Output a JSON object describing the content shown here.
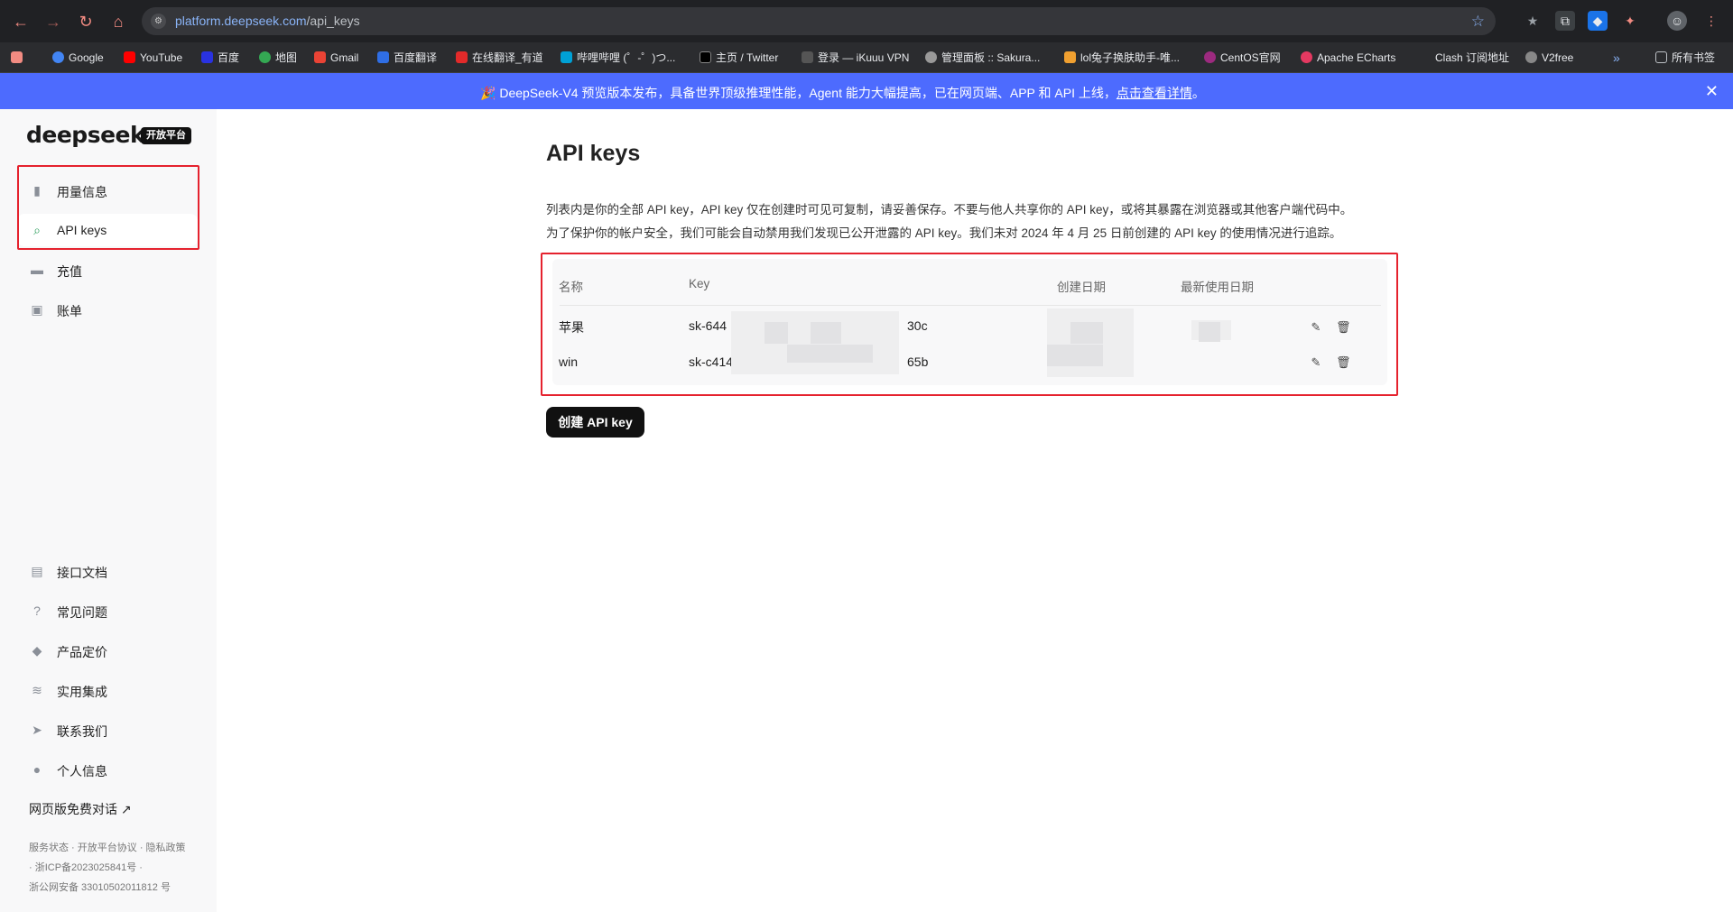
{
  "browser": {
    "url_host": "platform.deepseek.com",
    "url_path": "/api_keys",
    "bookmarks": [
      {
        "label": "Google",
        "color": "#4285f4"
      },
      {
        "label": "YouTube",
        "color": "#ff0000"
      },
      {
        "label": "百度",
        "color": "#2932e1"
      },
      {
        "label": "地图",
        "color": "#34a853"
      },
      {
        "label": "Gmail",
        "color": "#ea4335"
      },
      {
        "label": "百度翻译",
        "color": "#2f6ee5"
      },
      {
        "label": "在线翻译_有道",
        "color": "#e32a2a"
      },
      {
        "label": "哔哩哔哩 (゜-゜)つ...",
        "color": "#00a1d6"
      },
      {
        "label": "主页 / Twitter",
        "color": "#000000"
      },
      {
        "label": "登录 — iKuuu VPN",
        "color": "#555555"
      },
      {
        "label": "管理面板 :: Sakura...",
        "color": "#999999"
      },
      {
        "label": "lol兔子换肤助手-唯...",
        "color": "#f0a030"
      },
      {
        "label": "CentOS官网",
        "color": "#9c2a7f"
      },
      {
        "label": "Apache ECharts",
        "color": "#e43961"
      },
      {
        "label": "Clash 订阅地址",
        "color": ""
      },
      {
        "label": "V2free",
        "color": "#888888"
      }
    ],
    "more_bookmarks": "»",
    "all_bookmarks": "所有书签"
  },
  "announcement": {
    "text": "DeepSeek-V4 预览版本发布，具备世界顶级推理性能，Agent 能力大幅提高，已在网页端、APP 和 API 上线，",
    "link": "点击查看详情",
    "end": "。"
  },
  "sidebar": {
    "logo": "deepseek",
    "badge": "开放平台",
    "items": [
      {
        "label": "用量信息",
        "icon": "bar-chart-icon"
      },
      {
        "label": "API keys",
        "icon": "search-icon"
      },
      {
        "label": "充值",
        "icon": "credit-card-icon"
      },
      {
        "label": "账单",
        "icon": "bill-icon"
      }
    ],
    "bottom_items": [
      {
        "label": "接口文档",
        "icon": "document-icon"
      },
      {
        "label": "常见问题",
        "icon": "help-icon"
      },
      {
        "label": "产品定价",
        "icon": "tag-icon"
      },
      {
        "label": "实用集成",
        "icon": "layers-icon"
      },
      {
        "label": "联系我们",
        "icon": "send-icon"
      },
      {
        "label": "个人信息",
        "icon": "user-icon"
      }
    ],
    "web_chat": "网页版免费对话",
    "footer_line1": "服务状态 · 开放平台协议 · 隐私政策",
    "footer_line2": "· 浙ICP备2023025841号 ·",
    "footer_line3": "浙公网安备 33010502011812 号"
  },
  "main": {
    "title": "API keys",
    "desc_line1": "列表内是你的全部 API key，API key 仅在创建时可见可复制，请妥善保存。不要与他人共享你的 API key，或将其暴露在浏览器或其他客户端代码中。",
    "desc_line2": "为了保护你的帐户安全，我们可能会自动禁用我们发现已公开泄露的 API key。我们未对 2024 年 4 月 25 日前创建的 API key 的使用情况进行追踪。",
    "columns": [
      "名称",
      "Key",
      "创建日期",
      "最新使用日期"
    ],
    "rows": [
      {
        "name": "苹果",
        "key_prefix": "sk-644",
        "key_suffix": "30c"
      },
      {
        "name": "win",
        "key_prefix": "sk-c414",
        "key_suffix": "65b"
      }
    ],
    "create_button": "创建 API key"
  }
}
